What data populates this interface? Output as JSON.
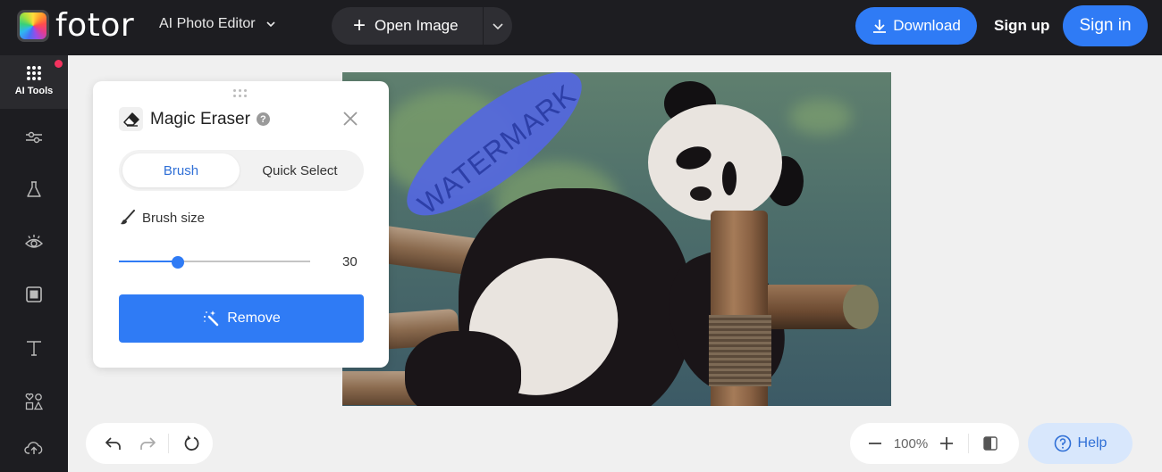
{
  "header": {
    "logo_text": "fotor",
    "product_menu_label": "AI Photo Editor",
    "open_image_label": "Open Image",
    "download_label": "Download",
    "sign_up_label": "Sign up",
    "sign_in_label": "Sign in",
    "accent_color": "#2f7bf5"
  },
  "sidebar": {
    "active_label": "AI Tools",
    "has_notification": true,
    "items": [
      {
        "name": "adjust",
        "icon": "sliders-icon"
      },
      {
        "name": "effects",
        "icon": "flask-icon"
      },
      {
        "name": "beauty",
        "icon": "eye-icon"
      },
      {
        "name": "frames",
        "icon": "frame-icon"
      },
      {
        "name": "text",
        "icon": "text-icon"
      },
      {
        "name": "elements",
        "icon": "shapes-icon"
      },
      {
        "name": "uploads",
        "icon": "cloud-upload-icon"
      }
    ]
  },
  "canvas": {
    "image_subject": "Giant panda resting on wooden post",
    "watermark_text": "WATERMARK",
    "mask_color": "#5467e0"
  },
  "panel": {
    "title": "Magic Eraser",
    "help_symbol": "?",
    "modes": [
      "Brush",
      "Quick Select"
    ],
    "active_mode": "Brush",
    "brush_size_label": "Brush size",
    "brush_size_value": "30",
    "brush_size_fraction": 0.31,
    "remove_label": "Remove"
  },
  "bottom": {
    "zoom_level": "100%",
    "help_label": "Help"
  }
}
